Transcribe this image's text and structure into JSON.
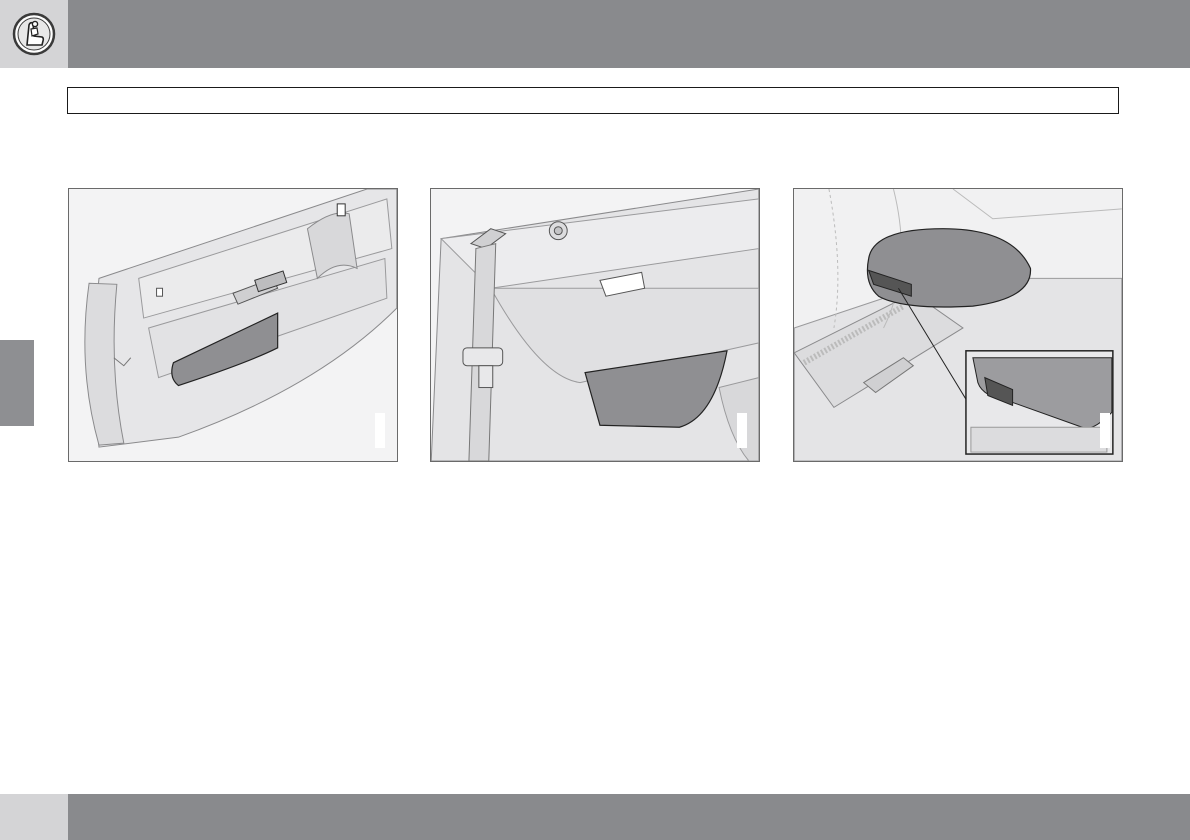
{
  "header": {
    "chapter_icon": "seat-person-icon",
    "title": "",
    "colors": {
      "bar": "#898a8d",
      "bar_light": "#d4d4d6"
    }
  },
  "figures": [
    {
      "name": "door-storage-pocket",
      "label": ""
    },
    {
      "name": "side-panel-storage-pocket",
      "label": ""
    },
    {
      "name": "armrest-storage-compartment",
      "label": ""
    }
  ],
  "footer": {
    "page_number": ""
  }
}
